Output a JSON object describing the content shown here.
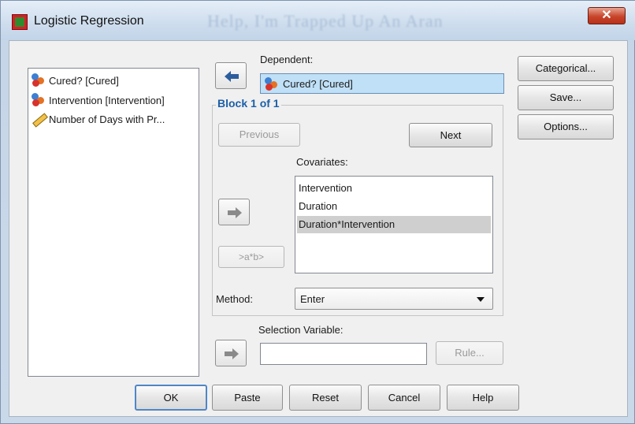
{
  "window": {
    "title": "Logistic Regression",
    "background_text": "Help, I'm Trapped Up An Aran",
    "close_glyph": "✕"
  },
  "variables": [
    {
      "label": "Cured? [Cured]",
      "icon": "nominal-icon"
    },
    {
      "label": "Intervention [Intervention]",
      "icon": "nominal-icon"
    },
    {
      "label": "Number of Days with Pr...",
      "icon": "scale-icon"
    }
  ],
  "dependent": {
    "label": "Dependent:",
    "value": "Cured? [Cured]",
    "icon": "nominal-icon"
  },
  "block": {
    "title": "Block 1 of 1",
    "previous_label": "Previous",
    "next_label": "Next",
    "covariates_label": "Covariates:",
    "covariates": [
      "Intervention",
      "Duration",
      "Duration*Intervention"
    ],
    "selected_index": 2,
    "interaction_label": ">a*b>",
    "method_label": "Method:",
    "method_value": "Enter"
  },
  "selection": {
    "label": "Selection Variable:",
    "value": "",
    "rule_label": "Rule..."
  },
  "side_buttons": {
    "categorical": "Categorical...",
    "save": "Save...",
    "options": "Options..."
  },
  "bottom_buttons": {
    "ok": "OK",
    "paste": "Paste",
    "reset": "Reset",
    "cancel": "Cancel",
    "help": "Help"
  },
  "colors": {
    "accent_blue": "#1c5fa8",
    "selection_field": "#bfe0f6",
    "close_red": "#c7452b"
  }
}
